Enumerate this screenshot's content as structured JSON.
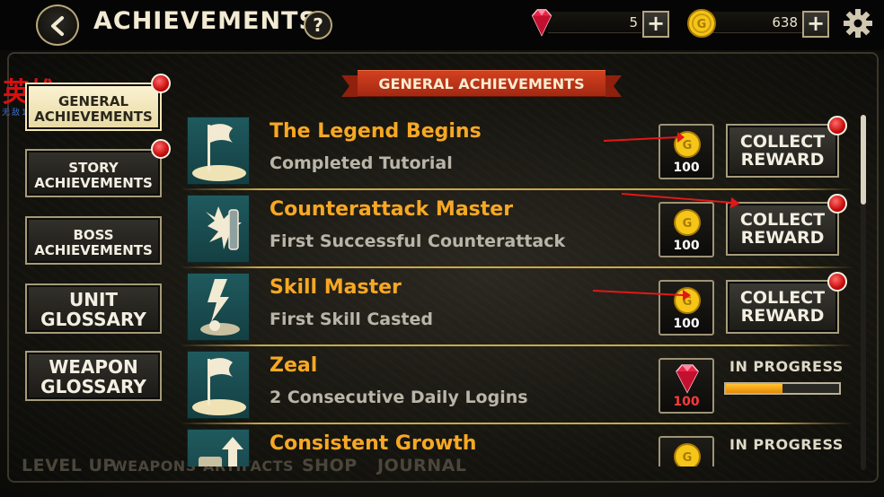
{
  "header": {
    "title": "ACHIEVEMENTS",
    "help_label": "?",
    "gems": "5",
    "gold": "638",
    "plus_label": "+"
  },
  "background_tabs": [
    "LEVEL UP",
    "WEAPONS",
    "ARTIFACTS",
    "SHOP",
    "JOURNAL"
  ],
  "watermark": {
    "main": "英雄",
    "sub": "无敌1.6.6"
  },
  "sidebar": [
    {
      "label": "GENERAL ACHIEVEMENTS",
      "active": true,
      "notification": true
    },
    {
      "label": "STORY ACHIEVEMENTS",
      "active": false,
      "notification": true
    },
    {
      "label": "BOSS ACHIEVEMENTS",
      "active": false,
      "notification": false
    },
    {
      "label": "UNIT GLOSSARY",
      "active": false,
      "notification": false
    },
    {
      "label": "WEAPON GLOSSARY",
      "active": false,
      "notification": false
    }
  ],
  "section_title": "GENERAL ACHIEVEMENTS",
  "achievements": [
    {
      "title": "The Legend Begins",
      "desc": "Completed Tutorial",
      "icon": "flag-icon",
      "reward_type": "gold",
      "reward": "100",
      "state": "collect",
      "button": "COLLECT REWARD"
    },
    {
      "title": "Counterattack Master",
      "desc": "First Successful Counterattack",
      "icon": "shield-burst-icon",
      "reward_type": "gold",
      "reward": "100",
      "state": "collect",
      "button": "COLLECT REWARD"
    },
    {
      "title": "Skill Master",
      "desc": "First Skill Casted",
      "icon": "lightning-icon",
      "reward_type": "gold",
      "reward": "100",
      "state": "collect",
      "button": "COLLECT REWARD"
    },
    {
      "title": "Zeal",
      "desc": "2 Consecutive Daily Logins",
      "icon": "flag-icon",
      "reward_type": "gem",
      "reward": "100",
      "state": "in_progress",
      "status": "IN PROGRESS",
      "progress": 0.5
    },
    {
      "title": "Consistent Growth",
      "desc": "",
      "icon": "growth-arrow-icon",
      "reward_type": "gold",
      "reward": "",
      "state": "in_progress",
      "status": "IN PROGRESS",
      "progress": 0.0
    }
  ],
  "colors": {
    "accent_title": "#f7a823",
    "ribbon": "#c3361a",
    "notification": "#d01010",
    "progress": "#ffb020"
  }
}
